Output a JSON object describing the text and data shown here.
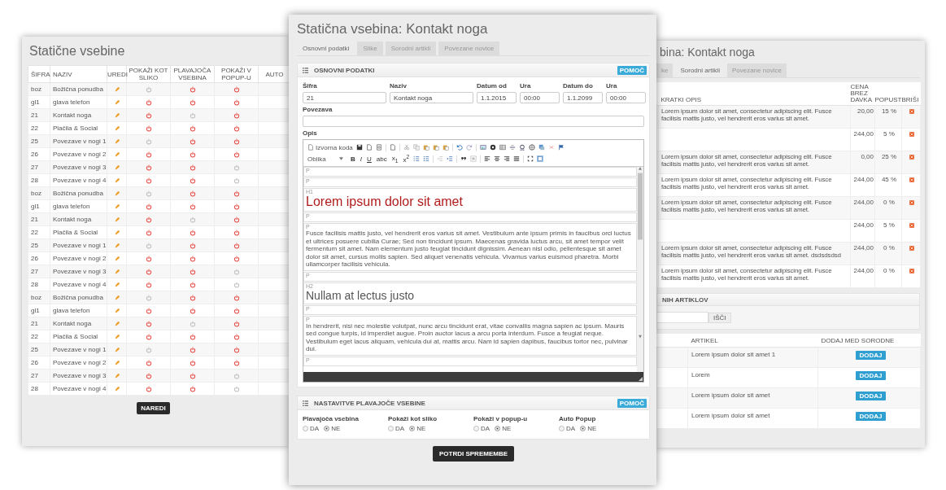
{
  "list_window": {
    "title": "Statične vsebine",
    "columns": [
      "ŠIFRA",
      "NAZIV",
      "UREDI",
      "POKAŽI KOT SLIKO",
      "PLAVAJOČA VSEBINA",
      "POKAŽI V POPUP-U",
      "AUTO"
    ],
    "rows": [
      {
        "code": "boz",
        "name": "Božična ponudba",
        "show_as_image": false,
        "floating": true,
        "popup": true
      },
      {
        "code": "gl1",
        "name": "glava telefon",
        "show_as_image": true,
        "floating": true,
        "popup": true
      },
      {
        "code": "21",
        "name": "Kontakt noga",
        "show_as_image": true,
        "floating": false,
        "popup": true
      },
      {
        "code": "22",
        "name": "Plačila & Social",
        "show_as_image": true,
        "floating": true,
        "popup": true
      },
      {
        "code": "25",
        "name": "Povezave v nogi 1",
        "show_as_image": false,
        "floating": true,
        "popup": true
      },
      {
        "code": "26",
        "name": "Povezave v nogi 2",
        "show_as_image": true,
        "floating": true,
        "popup": true
      },
      {
        "code": "27",
        "name": "Povezave v nogi 3",
        "show_as_image": true,
        "floating": true,
        "popup": false
      },
      {
        "code": "28",
        "name": "Povezave v nogi 4",
        "show_as_image": true,
        "floating": true,
        "popup": false
      },
      {
        "code": "boz",
        "name": "Božična ponudba",
        "show_as_image": false,
        "floating": true,
        "popup": true
      },
      {
        "code": "gl1",
        "name": "glava telefon",
        "show_as_image": true,
        "floating": true,
        "popup": true
      },
      {
        "code": "21",
        "name": "Kontakt noga",
        "show_as_image": true,
        "floating": false,
        "popup": true
      },
      {
        "code": "22",
        "name": "Plačila & Social",
        "show_as_image": true,
        "floating": true,
        "popup": true
      },
      {
        "code": "25",
        "name": "Povezave v nogi 1",
        "show_as_image": false,
        "floating": true,
        "popup": true
      },
      {
        "code": "26",
        "name": "Povezave v nogi 2",
        "show_as_image": true,
        "floating": true,
        "popup": true
      },
      {
        "code": "27",
        "name": "Povezave v nogi 3",
        "show_as_image": true,
        "floating": true,
        "popup": false
      },
      {
        "code": "28",
        "name": "Povezave v nogi 4",
        "show_as_image": true,
        "floating": true,
        "popup": false
      },
      {
        "code": "boz",
        "name": "Božična ponudba",
        "show_as_image": false,
        "floating": true,
        "popup": true
      },
      {
        "code": "gl1",
        "name": "glava telefon",
        "show_as_image": true,
        "floating": true,
        "popup": true
      },
      {
        "code": "21",
        "name": "Kontakt noga",
        "show_as_image": true,
        "floating": false,
        "popup": true
      },
      {
        "code": "22",
        "name": "Plačila & Social",
        "show_as_image": true,
        "floating": true,
        "popup": true
      },
      {
        "code": "25",
        "name": "Povezave v nogi 1",
        "show_as_image": false,
        "floating": true,
        "popup": true
      },
      {
        "code": "26",
        "name": "Povezave v nogi 2",
        "show_as_image": true,
        "floating": true,
        "popup": true
      },
      {
        "code": "27",
        "name": "Povezave v nogi 3",
        "show_as_image": true,
        "floating": true,
        "popup": false
      },
      {
        "code": "28",
        "name": "Povezave v nogi 4",
        "show_as_image": true,
        "floating": true,
        "popup": false
      }
    ],
    "button": "NAREDI"
  },
  "edit_window": {
    "title": "Statična vsebina: Kontakt noga",
    "tabs": [
      {
        "label": "Osnovni podatki",
        "selected": true
      },
      {
        "label": "Slike",
        "selected": false
      },
      {
        "label": "Sorodni artikli",
        "selected": false
      },
      {
        "label": "Povezane novice",
        "selected": false
      }
    ],
    "basic_panel": {
      "title": "OSNOVNI PODATKI",
      "help": "POMOČ",
      "fields": [
        {
          "label": "Šifra",
          "value": "21"
        },
        {
          "label": "Naziv",
          "value": "Kontakt noga"
        },
        {
          "label": "Datum od",
          "value": "1.1.2015"
        },
        {
          "label": "Ura",
          "value": "00:00"
        },
        {
          "label": "Datum do",
          "value": "1.1.2099"
        },
        {
          "label": "Ura",
          "value": "00:00"
        }
      ],
      "link_label": "Povezava",
      "description": {
        "label": "Opis",
        "source_label": "Izvorna koda",
        "format_label": "Oblika",
        "text_buttons": [
          "B",
          "I",
          "U",
          "abc",
          "x$_{1}$",
          "x$^{2}$"
        ],
        "blocks": [
          {
            "tag": "P",
            "kind": "p"
          },
          {
            "tag": "P",
            "kind": "p"
          },
          {
            "tag": "H1",
            "kind": "h1",
            "text": "Lorem ipsum dolor sit amet"
          },
          {
            "tag": "P",
            "kind": "p"
          },
          {
            "tag": "P",
            "kind": "p",
            "text": "Fusce facilisis mattis justo, vel hendrerit eros varius sit amet. Vestibulum ante ipsum primis in faucibus orci luctus et ultrices posuere cubilia Curae; Sed non tincidunt ipsum. Maecenas gravida luctus arcu, sit amet tempor velit fermentum sit amet. Nam elementum justo feugiat tincidunt dignissim. Aenean nisl odio, pellentesque sit amet dolor sit amet, cursus mollis sapien. Sed aliquet venenatis vehicula. Vivamus varius euismod pharetra. Morbi ullamcorper facilisis vehicula."
          },
          {
            "tag": "P",
            "kind": "p"
          },
          {
            "tag": "H2",
            "kind": "h2",
            "text": "Nullam at lectus justo"
          },
          {
            "tag": "P",
            "kind": "p"
          },
          {
            "tag": "P",
            "kind": "p",
            "text": "In hendrerit, nisi nec molestie volutpat, nunc arcu tincidunt erat, vitae convallis magna sapien ac ipsum. Mauris sed congue turpis, id imperdiet augue. Proin auctor lacus a arcu porta interdum. Fusce a feugiat neque. Vestibulum eget lacus aliquam, vehicula dui at, mattis arcu. Nam id sapien dapibus, faucibus tortor nec, pulvinar dui."
          },
          {
            "tag": "P",
            "kind": "p"
          }
        ]
      }
    },
    "float_panel": {
      "title": "NASTAVITVE PLAVAJOČE VSEBINE",
      "help": "POMOČ",
      "groups": [
        {
          "label": "Plavajoča vsebina",
          "options": [
            {
              "label": "DA",
              "selected": false
            },
            {
              "label": "NE",
              "selected": true
            }
          ]
        },
        {
          "label": "Pokaži kot sliko",
          "options": [
            {
              "label": "DA",
              "selected": false
            },
            {
              "label": "NE",
              "selected": true
            }
          ]
        },
        {
          "label": "Pokaži v popup-u",
          "options": [
            {
              "label": "DA",
              "selected": false
            },
            {
              "label": "NE",
              "selected": true
            }
          ]
        },
        {
          "label": "Auto Popup",
          "options": [
            {
              "label": "DA",
              "selected": false
            },
            {
              "label": "NE",
              "selected": true
            }
          ]
        }
      ]
    },
    "submit": "POTRDI SPREMEMBE"
  },
  "related_window": {
    "title": "bina: Kontakt noga",
    "tabs": [
      {
        "label": "ke",
        "selected": false
      },
      {
        "label": "Sorodni artikli",
        "selected": true
      },
      {
        "label": "Povezane novice",
        "selected": false
      }
    ],
    "columns": [
      "KRATKI OPIS",
      "CENA BREZ DAVKA",
      "POPUST",
      "BRIŠI"
    ],
    "rows": [
      {
        "description": "Lorem ipsum dolor sit amet, consectetur adipiscing elit. Fusce facilisis mattis justo, vel hendrerit eros varius sit amet.",
        "price": "20,00",
        "discount": "15 %"
      },
      {
        "description": "",
        "price": "244,00",
        "discount": "5 %"
      },
      {
        "description": "Lorem ipsum dolor sit amet, consectetur adipiscing elit. Fusce facilisis mattis justo, vel hendrerit eros varius sit amet.",
        "price": "0,00",
        "discount": "25 %"
      },
      {
        "description": "Lorem ipsum dolor sit amet, consectetur adipiscing elit. Fusce facilisis mattis justo, vel hendrerit eros varius sit amet.",
        "price": "244,00",
        "discount": "45 %"
      },
      {
        "description": "Lorem ipsum dolor sit amet, consectetur adipiscing elit. Fusce facilisis mattis justo, vel hendrerit eros varius sit amet.",
        "price": "244,00",
        "discount": "0 %"
      },
      {
        "description": "",
        "price": "244,00",
        "discount": "5 %"
      },
      {
        "description": "Lorem ipsum dolor sit amet, consectetur adipiscing elit. Fusce facilisis mattis justo, vel hendrerit eros varius sit amet. dsdsdsdsd",
        "price": "244,00",
        "discount": "0 %"
      },
      {
        "description": "Lorem ipsum dolor sit amet, consectetur adipiscing elit. Fusce facilisis mattis justo, vel hendrerit eros varius sit amet.",
        "price": "244,00",
        "discount": "0 %"
      }
    ],
    "search_panel": {
      "title": "NIH ARTIKLOV",
      "button": "IŠČI"
    },
    "results": {
      "columns": [
        "ARTIKEL",
        "DODAJ MED SORODNE"
      ],
      "rows": [
        {
          "name": "Lorem ipsum dolor sit amet 1",
          "button": "DODAJ"
        },
        {
          "name": "Lorem",
          "button": "DODAJ"
        },
        {
          "name": "Lorem ipsum dolor sit amet",
          "button": "DODAJ"
        },
        {
          "name": "Lorem ipsum dolor sit amet",
          "button": "DODAJ"
        }
      ]
    }
  }
}
